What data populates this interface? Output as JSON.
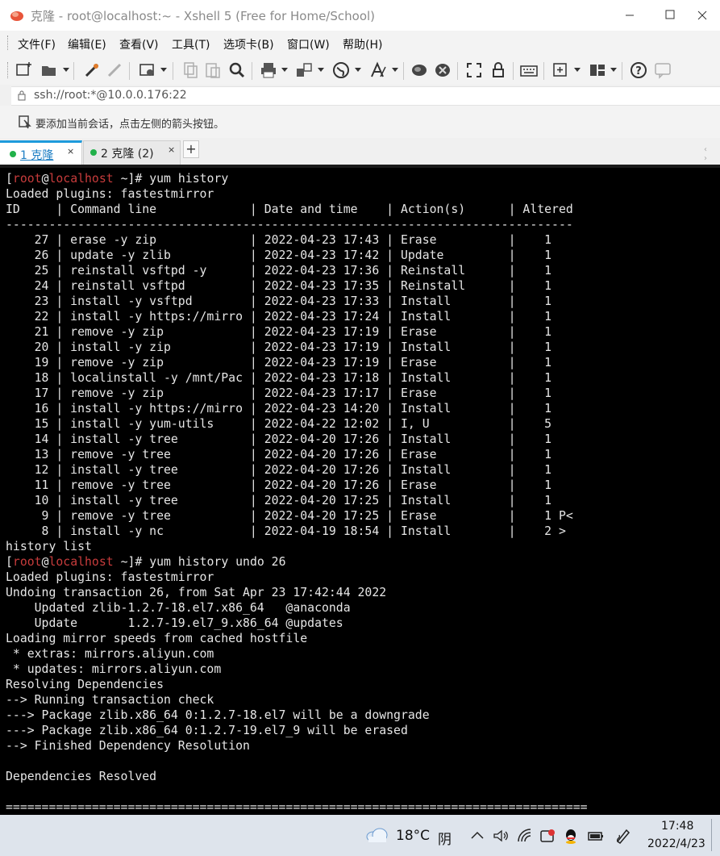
{
  "window": {
    "title": "克隆 - root@localhost:~ - Xshell 5 (Free for Home/School)"
  },
  "menu": [
    "文件(F)",
    "编辑(E)",
    "查看(V)",
    "工具(T)",
    "选项卡(B)",
    "窗口(W)",
    "帮助(H)"
  ],
  "address": "ssh://root:*@10.0.0.176:22",
  "hint": "要添加当前会话，点击左侧的箭头按钮。",
  "tabs": [
    {
      "label": "1 克隆",
      "active": true,
      "close": "×"
    },
    {
      "label": "2 克隆 (2)",
      "active": false,
      "close": "×"
    }
  ],
  "tab_add": "+",
  "prompt": {
    "user": "root",
    "host": "localhost",
    "dir": "~"
  },
  "terminal": {
    "line01_cmd": "]# yum history",
    "line02": "Loaded plugins: fastestmirror",
    "line03": "ID     | Command line             | Date and time    | Action(s)      | Altered",
    "line04": "-------------------------------------------------------------------------------",
    "line05": "    27 | erase -y zip             | 2022-04-23 17:43 | Erase          |    1",
    "line06": "    26 | update -y zlib           | 2022-04-23 17:42 | Update         |    1",
    "line07": "    25 | reinstall vsftpd -y      | 2022-04-23 17:36 | Reinstall      |    1",
    "line08": "    24 | reinstall vsftpd         | 2022-04-23 17:35 | Reinstall      |    1",
    "line09": "    23 | install -y vsftpd        | 2022-04-23 17:33 | Install        |    1",
    "line10": "    22 | install -y https://mirro | 2022-04-23 17:24 | Install        |    1",
    "line11": "    21 | remove -y zip            | 2022-04-23 17:19 | Erase          |    1",
    "line12": "    20 | install -y zip           | 2022-04-23 17:19 | Install        |    1",
    "line13": "    19 | remove -y zip            | 2022-04-23 17:19 | Erase          |    1",
    "line14": "    18 | localinstall -y /mnt/Pac | 2022-04-23 17:18 | Install        |    1",
    "line15": "    17 | remove -y zip            | 2022-04-23 17:17 | Erase          |    1",
    "line16": "    16 | install -y https://mirro | 2022-04-23 14:20 | Install        |    1",
    "line17": "    15 | install -y yum-utils     | 2022-04-22 12:02 | I, U           |    5",
    "line18": "    14 | install -y tree          | 2022-04-20 17:26 | Install        |    1",
    "line19": "    13 | remove -y tree           | 2022-04-20 17:26 | Erase          |    1",
    "line20": "    12 | install -y tree          | 2022-04-20 17:26 | Install        |    1",
    "line21": "    11 | remove -y tree           | 2022-04-20 17:26 | Erase          |    1",
    "line22": "    10 | install -y tree          | 2022-04-20 17:25 | Install        |    1",
    "line23": "     9 | remove -y tree           | 2022-04-20 17:25 | Erase          |    1 P<",
    "line24": "     8 | install -y nc            | 2022-04-19 18:54 | Install        |    2 >",
    "line25": "history list",
    "line26_cmd": "]# yum history undo 26",
    "line27": "Loaded plugins: fastestmirror",
    "line28": "Undoing transaction 26, from Sat Apr 23 17:42:44 2022",
    "line29": "    Updated zlib-1.2.7-18.el7.x86_64   @anaconda",
    "line30": "    Update       1.2.7-19.el7_9.x86_64 @updates",
    "line31": "Loading mirror speeds from cached hostfile",
    "line32": " * extras: mirrors.aliyun.com",
    "line33": " * updates: mirrors.aliyun.com",
    "line34": "Resolving Dependencies",
    "line35": "--> Running transaction check",
    "line36": "---> Package zlib.x86_64 0:1.2.7-18.el7 will be a downgrade",
    "line37": "---> Package zlib.x86_64 0:1.2.7-19.el7_9 will be erased",
    "line38": "--> Finished Dependency Resolution",
    "line39": "",
    "line40": "Dependencies Resolved",
    "line41": "",
    "line42": "================================================================================="
  },
  "taskbar": {
    "temperature": "18°C",
    "condition": "阴",
    "time": "17:48",
    "date": "2022/4/23"
  },
  "colors": {
    "accent": "#1e9bdc",
    "prompt_red": "#c83c3c",
    "terminal_bg": "#000000",
    "terminal_fg": "#e6e6e6"
  },
  "icons": [
    "new-session-icon",
    "open-folder-icon",
    "connect-icon",
    "disconnect-icon",
    "properties-icon",
    "copy-icon",
    "paste-icon",
    "find-icon",
    "print-icon",
    "transfer-icon",
    "globe-icon",
    "font-icon",
    "xftp-icon",
    "xmanager-icon",
    "fullscreen-icon",
    "lock-icon",
    "keyboard-icon",
    "add-pane-icon",
    "layout-icon",
    "help-icon",
    "chat-icon"
  ]
}
